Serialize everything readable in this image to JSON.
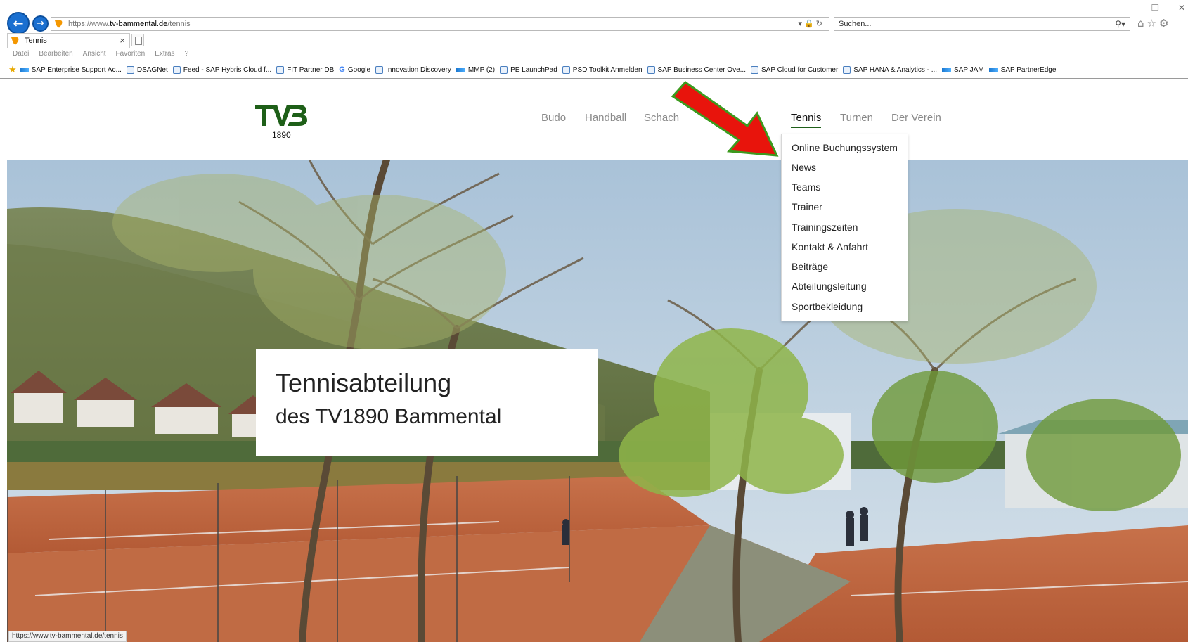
{
  "browser": {
    "url": {
      "scheme": "https://www.",
      "host": "tv-bammental.de",
      "path": "/tennis"
    },
    "search_placeholder": "Suchen...",
    "tab_title": "Tennis",
    "menu": [
      "Datei",
      "Bearbeiten",
      "Ansicht",
      "Favoriten",
      "Extras",
      "?"
    ],
    "favorites": [
      {
        "label": "SAP Enterprise Support Ac...",
        "icon": "sap"
      },
      {
        "label": "DSAGNet",
        "icon": "ie"
      },
      {
        "label": "Feed - SAP Hybris Cloud f...",
        "icon": "ie"
      },
      {
        "label": "FIT Partner DB",
        "icon": "ie"
      },
      {
        "label": "Google",
        "icon": "google"
      },
      {
        "label": "Innovation Discovery",
        "icon": "ie"
      },
      {
        "label": "MMP (2)",
        "icon": "sap"
      },
      {
        "label": "PE LaunchPad",
        "icon": "ie"
      },
      {
        "label": "PSD Toolkit Anmelden",
        "icon": "ie"
      },
      {
        "label": "SAP  Business Center  Ove...",
        "icon": "ie"
      },
      {
        "label": "SAP Cloud for Customer",
        "icon": "ie"
      },
      {
        "label": "SAP HANA & Analytics - ...",
        "icon": "ie"
      },
      {
        "label": "SAP JAM",
        "icon": "sap"
      },
      {
        "label": "SAP PartnerEdge",
        "icon": "sap"
      }
    ],
    "status_text": "https://www.tv-bammental.de/tennis"
  },
  "site": {
    "logo_word": "TVB",
    "logo_year": "1890",
    "nav": {
      "budo": "Budo",
      "handball": "Handball",
      "schach": "Schach",
      "tennis": "Tennis",
      "turnen": "Turnen",
      "der_verein": "Der Verein"
    },
    "dropdown": [
      "Online Buchungssystem",
      "News",
      "Teams",
      "Trainer",
      "Trainingszeiten",
      "Kontakt & Anfahrt",
      "Beiträge",
      "Abteilungsleitung",
      "Sportbekleidung"
    ],
    "hero": {
      "title": "Tennisabteilung",
      "subtitle": "des TV1890 Bammental"
    }
  },
  "colors": {
    "brand_green": "#1e5f18",
    "annotation_red": "#e8140c",
    "annotation_outline": "#3c9a1e",
    "clay": "#c4663f"
  }
}
